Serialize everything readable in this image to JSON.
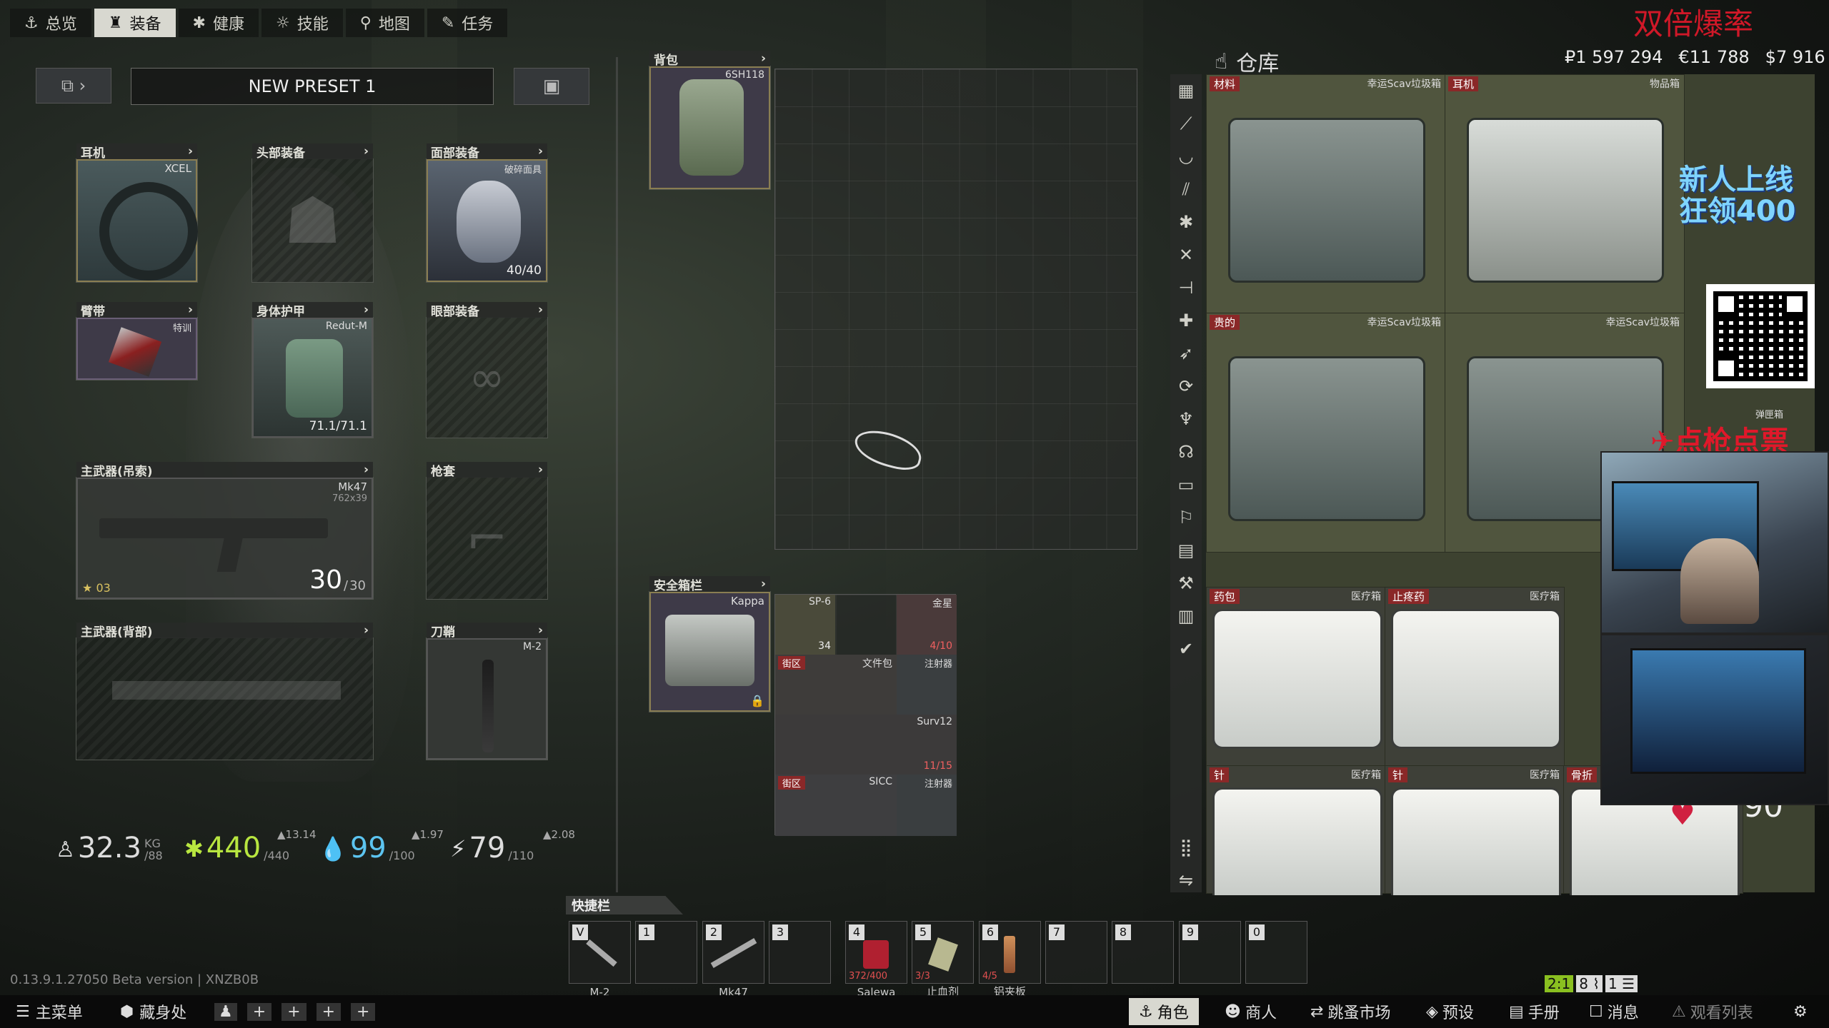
{
  "tabs": [
    {
      "label": "总览",
      "icon": "anchor-icon"
    },
    {
      "label": "装备",
      "icon": "gear-person-icon"
    },
    {
      "label": "健康",
      "icon": "health-icon"
    },
    {
      "label": "技能",
      "icon": "skills-icon"
    },
    {
      "label": "地图",
      "icon": "map-pin-icon"
    },
    {
      "label": "任务",
      "icon": "tasks-icon"
    }
  ],
  "preset": {
    "name": "NEW PRESET 1"
  },
  "slots": {
    "earpiece": {
      "label": "耳机",
      "item": "XCEL"
    },
    "headwear": {
      "label": "头部装备"
    },
    "faceCover": {
      "label": "面部装备",
      "item": "破碎面具",
      "value": "40/40"
    },
    "armband": {
      "label": "臂带",
      "item": "特训"
    },
    "bodyArmor": {
      "label": "身体护甲",
      "item": "Redut-M",
      "value": "71.1/71.1"
    },
    "eyewear": {
      "label": "眼部装备"
    },
    "primarySling": {
      "label": "主武器(吊索)",
      "item": "Mk47",
      "sub": "762x39",
      "ammo": "30",
      "ammoMax": "30",
      "level": "03"
    },
    "holster": {
      "label": "枪套"
    },
    "primaryBack": {
      "label": "主武器(背部)"
    },
    "scabbard": {
      "label": "刀鞘",
      "item": "M-2"
    },
    "backpack": {
      "label": "背包",
      "item": "6SH118"
    },
    "securedContainer": {
      "label": "安全箱栏",
      "item": "Kappa"
    }
  },
  "stats": {
    "weight": "32.3",
    "weightMax": "88",
    "weightUnit": "KG",
    "health": "440",
    "healthMax": "440",
    "healthRate": "13.14",
    "hydration": "99",
    "hydrationMax": "100",
    "hydrationRate": "1.97",
    "energy": "79",
    "energyMax": "110",
    "energyRate": "2.08"
  },
  "containerItems": [
    {
      "name": "SP-6",
      "count": "34",
      "tag": ""
    },
    {
      "name": "金星",
      "count": "4/10",
      "tag": ""
    },
    {
      "name": "文件包",
      "count": "",
      "tag": "街区"
    },
    {
      "name": "注射器",
      "count": "",
      "tag": ""
    },
    {
      "name": "Surv12",
      "count": "11/15",
      "tag": ""
    },
    {
      "name": "SICC",
      "count": "",
      "tag": "街区"
    },
    {
      "name": "注射器",
      "count": "",
      "tag": ""
    }
  ],
  "stash": {
    "title": "仓库",
    "money": {
      "rub": "₽1 597 294",
      "eur": "€11 788",
      "usd": "$7 916"
    },
    "cells": [
      {
        "badge": "材料",
        "type": "幸运Scav垃圾箱"
      },
      {
        "badge": "耳机",
        "type": "物品箱"
      },
      {
        "badge": "贵的",
        "type": "幸运Scav垃圾箱"
      },
      {
        "badge": "",
        "type": "幸运Scav垃圾箱"
      },
      {
        "badge": "药包",
        "type": "医疗箱"
      },
      {
        "badge": "止疼药",
        "type": "医疗箱"
      },
      {
        "badge": "针",
        "type": "医疗箱"
      },
      {
        "badge": "针",
        "type": "医疗箱"
      },
      {
        "badge": "骨折",
        "type": ""
      }
    ],
    "sideMarker": "弹匣箱",
    "fourthCount": "90"
  },
  "quickbar": {
    "title": "快捷栏",
    "slots": [
      {
        "key": "V",
        "label": "M-2",
        "count": ""
      },
      {
        "key": "1",
        "label": "",
        "count": ""
      },
      {
        "key": "2",
        "label": "Mk47",
        "count": ""
      },
      {
        "key": "3",
        "label": "",
        "count": ""
      },
      {
        "key": "4",
        "label": "Salewa",
        "count": "372/400"
      },
      {
        "key": "5",
        "label": "止血剂",
        "count": "3/3"
      },
      {
        "key": "6",
        "label": "铝夹板",
        "count": "4/5"
      },
      {
        "key": "7",
        "label": "",
        "count": ""
      },
      {
        "key": "8",
        "label": "",
        "count": ""
      },
      {
        "key": "9",
        "label": "",
        "count": ""
      },
      {
        "key": "0",
        "label": "",
        "count": ""
      }
    ]
  },
  "version": "0.13.9.1.27050 Beta version | XNZB0B",
  "bottomLeft": [
    {
      "label": "主菜单"
    },
    {
      "label": "藏身处"
    }
  ],
  "bottomRight": [
    {
      "label": "角色",
      "active": true
    },
    {
      "label": "商人"
    },
    {
      "label": "跳蚤市场"
    },
    {
      "label": "预设"
    },
    {
      "label": "手册"
    },
    {
      "label": "消息"
    },
    {
      "label": "观看列表"
    }
  ],
  "statusBadges": {
    "a": "2:1",
    "b": "8",
    "c": "1"
  },
  "overlay": {
    "topRightText": "双倍爆率",
    "promo": "新人上线 狂领400",
    "promo2": "点枪点票"
  }
}
